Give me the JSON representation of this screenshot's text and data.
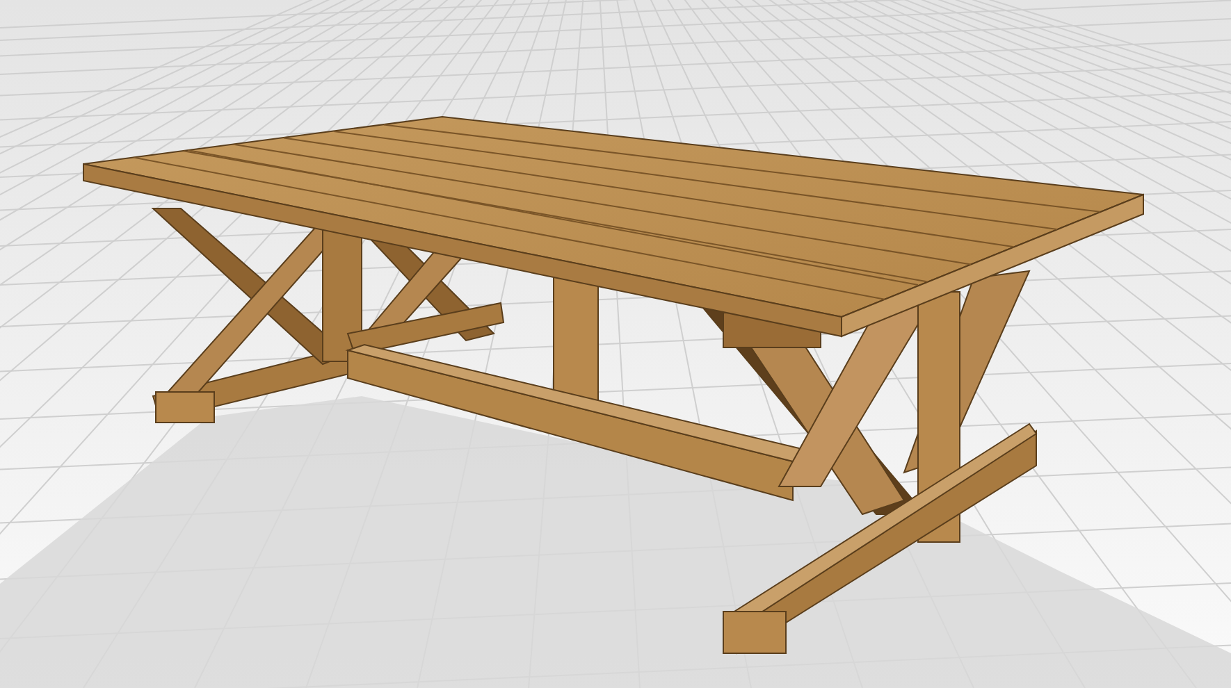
{
  "viewport": {
    "grid": true,
    "shadow": true
  }
}
